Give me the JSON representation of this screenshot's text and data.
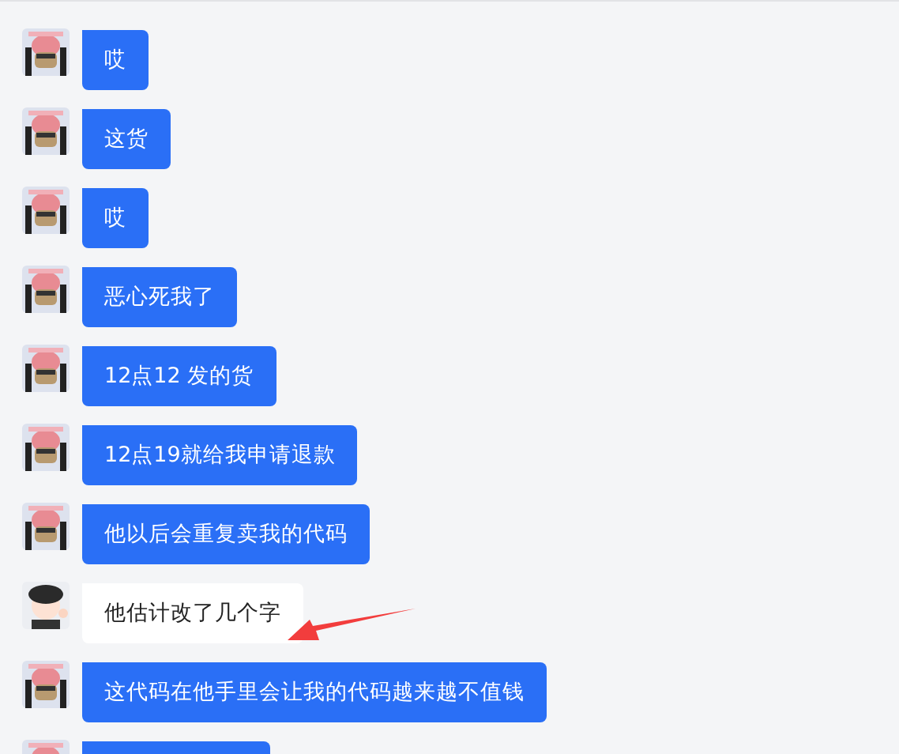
{
  "messages": [
    {
      "kind": "peer",
      "text": "哎"
    },
    {
      "kind": "peer",
      "text": "这货"
    },
    {
      "kind": "peer",
      "text": "哎"
    },
    {
      "kind": "peer",
      "text": "恶心死我了"
    },
    {
      "kind": "peer",
      "text": "12点12 发的货"
    },
    {
      "kind": "peer",
      "text": "12点19就给我申请退款"
    },
    {
      "kind": "peer",
      "text": "他以后会重复卖我的代码"
    },
    {
      "kind": "own",
      "text": "他估计改了几个字"
    },
    {
      "kind": "peer",
      "text": "这代码在他手里会让我的代码越来越不值钱"
    },
    {
      "kind": "peer"
    }
  ]
}
